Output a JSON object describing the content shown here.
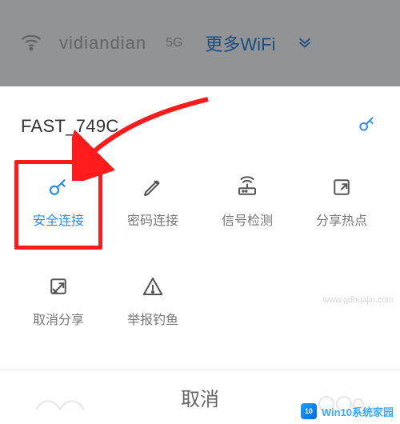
{
  "background": {
    "ssid": "vidiandian",
    "band": "5G",
    "more_wifi": "更多WiFi"
  },
  "sheet": {
    "title": "FAST_749C"
  },
  "tiles": [
    {
      "label": "安全连接",
      "icon": "key"
    },
    {
      "label": "密码连接",
      "icon": "pencil"
    },
    {
      "label": "信号检测",
      "icon": "router"
    },
    {
      "label": "分享热点",
      "icon": "share"
    },
    {
      "label": "取消分享",
      "icon": "share-x"
    },
    {
      "label": "举报钓鱼",
      "icon": "warning"
    }
  ],
  "footer": {
    "cancel": "取消"
  },
  "watermarks": {
    "wm1": "www.qdhuajin.com",
    "wm2_badge": "10",
    "wm2_text": "Win10系统家园"
  },
  "colors": {
    "accent": "#2a8bf2",
    "highlight": "#ff1b1b"
  }
}
